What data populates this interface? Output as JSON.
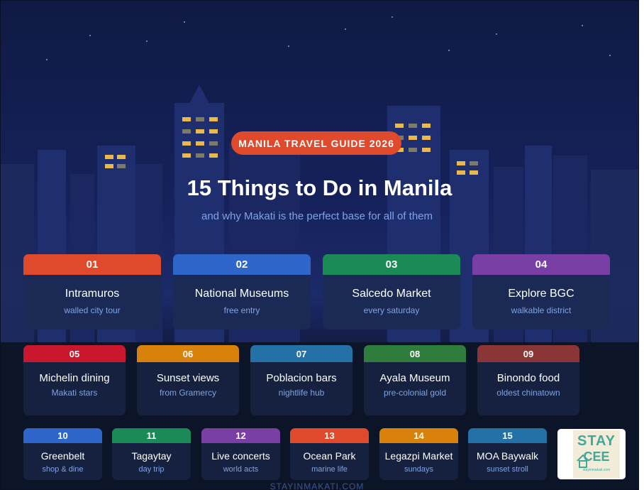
{
  "header": {
    "badge": "MANILA TRAVEL GUIDE 2026",
    "title": "15 Things to Do in Manila",
    "subtitle": "and why Makati is the perfect base for all of them"
  },
  "colors": {
    "red": "#e04a2c",
    "blue": "#2f66c9",
    "green": "#1b8a57",
    "purple": "#7a3fa5",
    "crimson": "#c9182e",
    "orange": "#d9820b",
    "steel": "#2471a8",
    "forest": "#2e7d3c",
    "brown": "#8b3636"
  },
  "things": [
    {
      "num": "01",
      "name": "Intramuros",
      "sub": "walled city tour",
      "color": "#e04a2c"
    },
    {
      "num": "02",
      "name": "National Museums",
      "sub": "free entry",
      "color": "#2f66c9"
    },
    {
      "num": "03",
      "name": "Salcedo Market",
      "sub": "every saturday",
      "color": "#1b8a57"
    },
    {
      "num": "04",
      "name": "Explore BGC",
      "sub": "walkable district",
      "color": "#7a3fa5"
    },
    {
      "num": "05",
      "name": "Michelin dining",
      "sub": "Makati stars",
      "color": "#c9182e"
    },
    {
      "num": "06",
      "name": "Sunset views",
      "sub": "from Gramercy",
      "color": "#d9820b"
    },
    {
      "num": "07",
      "name": "Poblacion bars",
      "sub": "nightlife hub",
      "color": "#2471a8"
    },
    {
      "num": "08",
      "name": "Ayala Museum",
      "sub": "pre-colonial gold",
      "color": "#2e7d3c"
    },
    {
      "num": "09",
      "name": "Binondo food",
      "sub": "oldest chinatown",
      "color": "#8b3636"
    },
    {
      "num": "10",
      "name": "Greenbelt",
      "sub": "shop & dine",
      "color": "#2f66c9"
    },
    {
      "num": "11",
      "name": "Tagaytay",
      "sub": "day trip",
      "color": "#1b8a57"
    },
    {
      "num": "12",
      "name": "Live concerts",
      "sub": "world acts",
      "color": "#7a3fa5"
    },
    {
      "num": "13",
      "name": "Ocean Park",
      "sub": "marine life",
      "color": "#e04a2c"
    },
    {
      "num": "14",
      "name": "Legazpi Market",
      "sub": "sundays",
      "color": "#d9820b"
    },
    {
      "num": "15",
      "name": "MOA Baywalk",
      "sub": "sunset stroll",
      "color": "#2471a8"
    }
  ],
  "logo": {
    "line1": "STAY",
    "line2": "CEE",
    "line3": "stayinmakati.com"
  },
  "footer": "STAYINMAKATI.COM"
}
